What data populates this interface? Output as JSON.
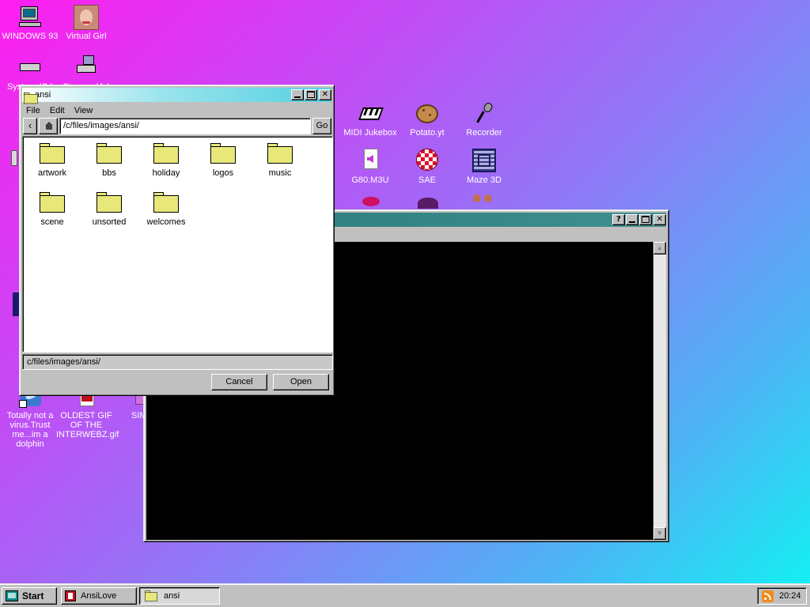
{
  "desktop": {
    "icons": [
      {
        "label": "WINDOWS 93"
      },
      {
        "label": "Virtual Girl"
      },
      {
        "label": "System (C:)"
      },
      {
        "label": "Storage (A:)"
      },
      {
        "label": "MIDI Jukebox"
      },
      {
        "label": "Potato.yt"
      },
      {
        "label": "Recorder"
      },
      {
        "label": "G80.M3U"
      },
      {
        "label": "SAE"
      },
      {
        "label": "Maze 3D"
      },
      {
        "label": "Totally not a virus.Trust me...im a dolphin"
      },
      {
        "label": "OLDEST GIF OF THE INTERWEBZ.gif"
      },
      {
        "label": "SIM"
      }
    ]
  },
  "explorer": {
    "title": "ansi",
    "menu": [
      "File",
      "Edit",
      "View"
    ],
    "path": "/c/files/images/ansi/",
    "go_label": "Go",
    "back_label": "‹",
    "folders": [
      "artwork",
      "bbs",
      "holiday",
      "logos",
      "music",
      "scene",
      "unsorted",
      "welcomes"
    ],
    "status_path": "c/files/images/ansi/",
    "cancel_label": "Cancel",
    "open_label": "Open"
  },
  "viewer": {
    "help_label": "?"
  },
  "taskbar": {
    "start_label": "Start",
    "tasks": [
      {
        "label": "AnsiLove"
      },
      {
        "label": "ansi"
      }
    ],
    "clock": "20:24"
  },
  "colors": {
    "title_active": "#7fd8e6",
    "title_inactive": "#3f8f8f",
    "folder": "#e8e87a",
    "chrome": "#c0c0c0"
  }
}
